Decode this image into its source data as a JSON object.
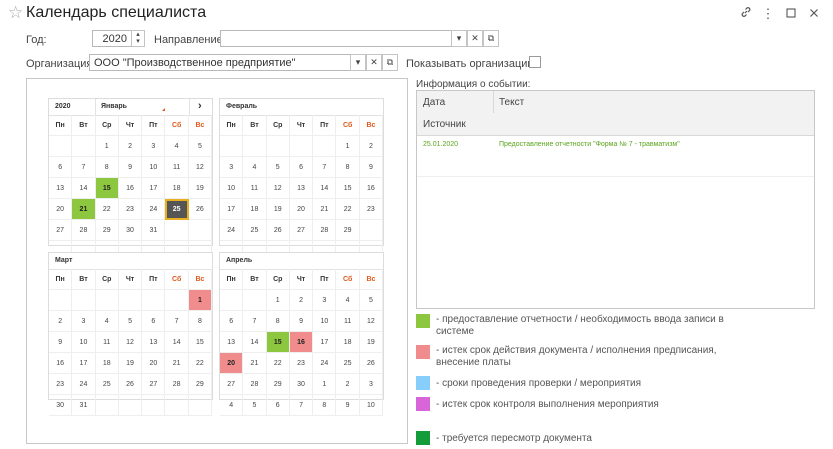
{
  "window": {
    "title": "Календарь специалиста",
    "icons": [
      "star-icon",
      "link-icon",
      "more-icon",
      "maximize-icon",
      "close-icon"
    ]
  },
  "form": {
    "year_label": "Год:",
    "year_value": "2020",
    "direction_label": "Направление:",
    "direction_value": "",
    "org_label": "Организация:",
    "org_value": "ООО \"Производственное предприятие\"",
    "show_org_label": "Показывать организацию:",
    "show_org_checked": false,
    "arrow_down": "▾",
    "clear": "✕",
    "open": "⧉",
    "spin": "▴▾"
  },
  "calendar": {
    "weekdays": [
      "Пн",
      "Вт",
      "Ср",
      "Чт",
      "Пт",
      "Сб",
      "Вс"
    ],
    "year_cell": "2020",
    "nav_next": "›",
    "months": [
      {
        "name": "Январь",
        "rows": [
          [
            [
              "",
              ""
            ],
            [
              "",
              ""
            ],
            [
              "1",
              "in"
            ],
            [
              "2",
              "in"
            ],
            [
              "3",
              "in"
            ],
            [
              "4",
              "in"
            ],
            [
              "5",
              "in"
            ]
          ],
          [
            [
              "6",
              "in"
            ],
            [
              "7",
              "in"
            ],
            [
              "8",
              "in"
            ],
            [
              "9",
              "in"
            ],
            [
              "10",
              "in"
            ],
            [
              "11",
              "in"
            ],
            [
              "12",
              "in"
            ]
          ],
          [
            [
              "13",
              "in"
            ],
            [
              "14",
              "in"
            ],
            [
              "15",
              "g"
            ],
            [
              "16",
              "in"
            ],
            [
              "17",
              "in"
            ],
            [
              "18",
              "in"
            ],
            [
              "19",
              "in"
            ]
          ],
          [
            [
              "20",
              "in"
            ],
            [
              "21",
              "g"
            ],
            [
              "22",
              "in"
            ],
            [
              "23",
              "in"
            ],
            [
              "24",
              "in"
            ],
            [
              "25",
              "sel"
            ],
            [
              "26",
              "in"
            ]
          ],
          [
            [
              "27",
              "in"
            ],
            [
              "28",
              "in"
            ],
            [
              "29",
              "in"
            ],
            [
              "30",
              "in"
            ],
            [
              "31",
              "in"
            ],
            [
              "",
              ""
            ],
            [
              "",
              ""
            ]
          ],
          [
            [
              "",
              ""
            ],
            [
              "",
              ""
            ],
            [
              "",
              ""
            ],
            [
              "",
              ""
            ],
            [
              "",
              ""
            ],
            [
              "",
              ""
            ],
            [
              "",
              ""
            ]
          ]
        ]
      },
      {
        "name": "Февраль",
        "rows": [
          [
            [
              "",
              ""
            ],
            [
              "",
              ""
            ],
            [
              "",
              ""
            ],
            [
              "",
              ""
            ],
            [
              "",
              ""
            ],
            [
              "1",
              "in"
            ],
            [
              "2",
              "in"
            ]
          ],
          [
            [
              "3",
              "in"
            ],
            [
              "4",
              "in"
            ],
            [
              "5",
              "in"
            ],
            [
              "6",
              "in"
            ],
            [
              "7",
              "in"
            ],
            [
              "8",
              "in"
            ],
            [
              "9",
              "in"
            ]
          ],
          [
            [
              "10",
              "in"
            ],
            [
              "11",
              "in"
            ],
            [
              "12",
              "in"
            ],
            [
              "13",
              "in"
            ],
            [
              "14",
              "in"
            ],
            [
              "15",
              "in"
            ],
            [
              "16",
              "in"
            ]
          ],
          [
            [
              "17",
              "in"
            ],
            [
              "18",
              "in"
            ],
            [
              "19",
              "in"
            ],
            [
              "20",
              "in"
            ],
            [
              "21",
              "in"
            ],
            [
              "22",
              "in"
            ],
            [
              "23",
              "in"
            ]
          ],
          [
            [
              "24",
              "in"
            ],
            [
              "25",
              "in"
            ],
            [
              "26",
              "in"
            ],
            [
              "27",
              "in"
            ],
            [
              "28",
              "in"
            ],
            [
              "29",
              "in"
            ],
            [
              "",
              ""
            ]
          ],
          [
            [
              "",
              ""
            ],
            [
              "",
              ""
            ],
            [
              "",
              ""
            ],
            [
              "",
              ""
            ],
            [
              "",
              ""
            ],
            [
              "",
              ""
            ],
            [
              "",
              ""
            ]
          ]
        ]
      },
      {
        "name": "Март",
        "rows": [
          [
            [
              "",
              ""
            ],
            [
              "",
              ""
            ],
            [
              "",
              ""
            ],
            [
              "",
              ""
            ],
            [
              "",
              ""
            ],
            [
              "",
              ""
            ],
            [
              "1",
              "r"
            ]
          ],
          [
            [
              "2",
              "in"
            ],
            [
              "3",
              "in"
            ],
            [
              "4",
              "in"
            ],
            [
              "5",
              "in"
            ],
            [
              "6",
              "in"
            ],
            [
              "7",
              "in"
            ],
            [
              "8",
              "in"
            ]
          ],
          [
            [
              "9",
              "in"
            ],
            [
              "10",
              "in"
            ],
            [
              "11",
              "in"
            ],
            [
              "12",
              "in"
            ],
            [
              "13",
              "in"
            ],
            [
              "14",
              "in"
            ],
            [
              "15",
              "in"
            ]
          ],
          [
            [
              "16",
              "in"
            ],
            [
              "17",
              "in"
            ],
            [
              "18",
              "in"
            ],
            [
              "19",
              "in"
            ],
            [
              "20",
              "in"
            ],
            [
              "21",
              "in"
            ],
            [
              "22",
              "in"
            ]
          ],
          [
            [
              "23",
              "in"
            ],
            [
              "24",
              "in"
            ],
            [
              "25",
              "in"
            ],
            [
              "26",
              "in"
            ],
            [
              "27",
              "in"
            ],
            [
              "28",
              "in"
            ],
            [
              "29",
              "in"
            ]
          ],
          [
            [
              "30",
              "in"
            ],
            [
              "31",
              "in"
            ],
            [
              "",
              ""
            ],
            [
              "",
              ""
            ],
            [
              "",
              ""
            ],
            [
              "",
              ""
            ],
            [
              "",
              ""
            ]
          ]
        ]
      },
      {
        "name": "Апрель",
        "rows": [
          [
            [
              "",
              ""
            ],
            [
              "",
              ""
            ],
            [
              "1",
              "in"
            ],
            [
              "2",
              "in"
            ],
            [
              "3",
              "in"
            ],
            [
              "4",
              "in"
            ],
            [
              "5",
              "in"
            ]
          ],
          [
            [
              "6",
              "in"
            ],
            [
              "7",
              "in"
            ],
            [
              "8",
              "in"
            ],
            [
              "9",
              "in"
            ],
            [
              "10",
              "in"
            ],
            [
              "11",
              "in"
            ],
            [
              "12",
              "in"
            ]
          ],
          [
            [
              "13",
              "in"
            ],
            [
              "14",
              "in"
            ],
            [
              "15",
              "g"
            ],
            [
              "16",
              "r"
            ],
            [
              "17",
              "in"
            ],
            [
              "18",
              "in"
            ],
            [
              "19",
              "in"
            ]
          ],
          [
            [
              "20",
              "r"
            ],
            [
              "21",
              "in"
            ],
            [
              "22",
              "in"
            ],
            [
              "23",
              "in"
            ],
            [
              "24",
              "in"
            ],
            [
              "25",
              "in"
            ],
            [
              "26",
              "in"
            ]
          ],
          [
            [
              "27",
              "in"
            ],
            [
              "28",
              "in"
            ],
            [
              "29",
              "in"
            ],
            [
              "30",
              "in"
            ],
            [
              "1",
              "out"
            ],
            [
              "2",
              "out"
            ],
            [
              "3",
              "out"
            ]
          ],
          [
            [
              "4",
              "out"
            ],
            [
              "5",
              "out"
            ],
            [
              "6",
              "out"
            ],
            [
              "7",
              "out"
            ],
            [
              "8",
              "out"
            ],
            [
              "9",
              "out"
            ],
            [
              "10",
              "out"
            ]
          ]
        ]
      }
    ]
  },
  "event_info": {
    "label": "Информация о событии:",
    "col_date": "Дата",
    "col_text": "Текст",
    "col_source": "Источник",
    "rows": [
      {
        "date": "25.01.2020",
        "text": "Предоставление отчетности \"Форма № 7 - травматизм\""
      }
    ]
  },
  "legend": [
    {
      "color": "#8dc63f",
      "text": "- предоставление отчетности / необходимость ввода записи в системе",
      "name": "legend-green"
    },
    {
      "color": "#f08c8c",
      "text": "- истек срок действия документа / исполнения предписания, внесение платы",
      "name": "legend-red"
    },
    {
      "color": "#87cefa",
      "text": "- сроки проведения проверки / мероприятия",
      "name": "legend-blue"
    },
    {
      "color": "#d966d9",
      "text": "- истек срок контроля выполнения мероприятия",
      "name": "legend-purple"
    },
    {
      "color": "#149c3a",
      "text": "- требуется пересмотр документа",
      "name": "legend-dark-green"
    }
  ]
}
